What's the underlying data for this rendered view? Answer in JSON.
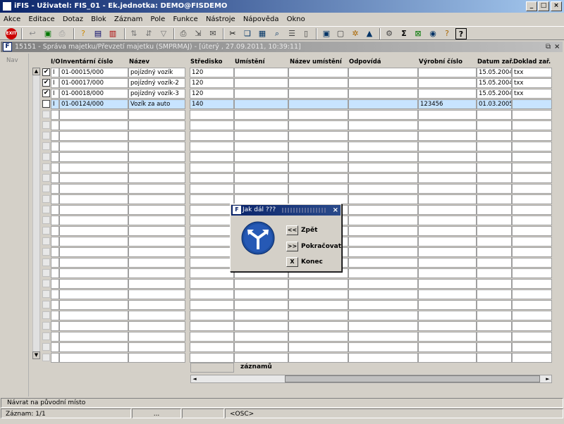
{
  "window": {
    "title": "iFIS - Uživatel: FIS_01 - Ek.jednotka: DEMO@FISDEMO"
  },
  "menu": [
    "Akce",
    "Editace",
    "Dotaz",
    "Blok",
    "Záznam",
    "Pole",
    "Funkce",
    "Nástroje",
    "Nápověda",
    "Okno"
  ],
  "form": {
    "title": "15151 - Správa majetku/Převzetí majetku (SMPRMAJ) - [úterý , 27.09.2011, 10:39:11]",
    "nav_label": "Nav"
  },
  "table": {
    "headers": {
      "io": "I/O",
      "inv": "Inventární číslo",
      "name": "Název",
      "center": "Středisko",
      "loc": "Umístění",
      "locname": "Název umístění",
      "resp": "Odpovídá",
      "serial": "Výrobní číslo",
      "date": "Datum zař.",
      "doc": "Doklad zař."
    },
    "rows": [
      {
        "checked": "✔",
        "io": "I",
        "inv": "01-00015/000",
        "name": "pojízdný vozík",
        "center": "120",
        "loc": "",
        "locname": "",
        "resp": "",
        "serial": "",
        "date": "15.05.2004",
        "doc": "txx"
      },
      {
        "checked": "✔",
        "io": "I",
        "inv": "01-00017/000",
        "name": "pojízdný vozík-2",
        "center": "120",
        "loc": "",
        "locname": "",
        "resp": "",
        "serial": "",
        "date": "15.05.2004",
        "doc": "txx"
      },
      {
        "checked": "✔",
        "io": "I",
        "inv": "01-00018/000",
        "name": "pojízdný vozík-3",
        "center": "120",
        "loc": "",
        "locname": "",
        "resp": "",
        "serial": "",
        "date": "15.05.2004",
        "doc": "txx"
      },
      {
        "checked": "",
        "io": "I",
        "inv": "01-00124/000",
        "name": "Vozík za auto",
        "center": "140",
        "loc": "",
        "locname": "",
        "resp": "",
        "serial": "123456",
        "date": "01.03.2005",
        "doc": ""
      }
    ],
    "records_label": "záznamů",
    "records_value": ""
  },
  "dialog": {
    "title": "Jak dál ???",
    "buttons": [
      {
        "key": "<<",
        "label": "Zpět"
      },
      {
        "key": ">>",
        "label": "Pokračovat"
      },
      {
        "key": "X",
        "label": "Konec"
      }
    ]
  },
  "status": {
    "message": "Návrat na původní místo",
    "record": "Záznam: 1/1",
    "sep": "...",
    "osc": "<OSC>"
  }
}
